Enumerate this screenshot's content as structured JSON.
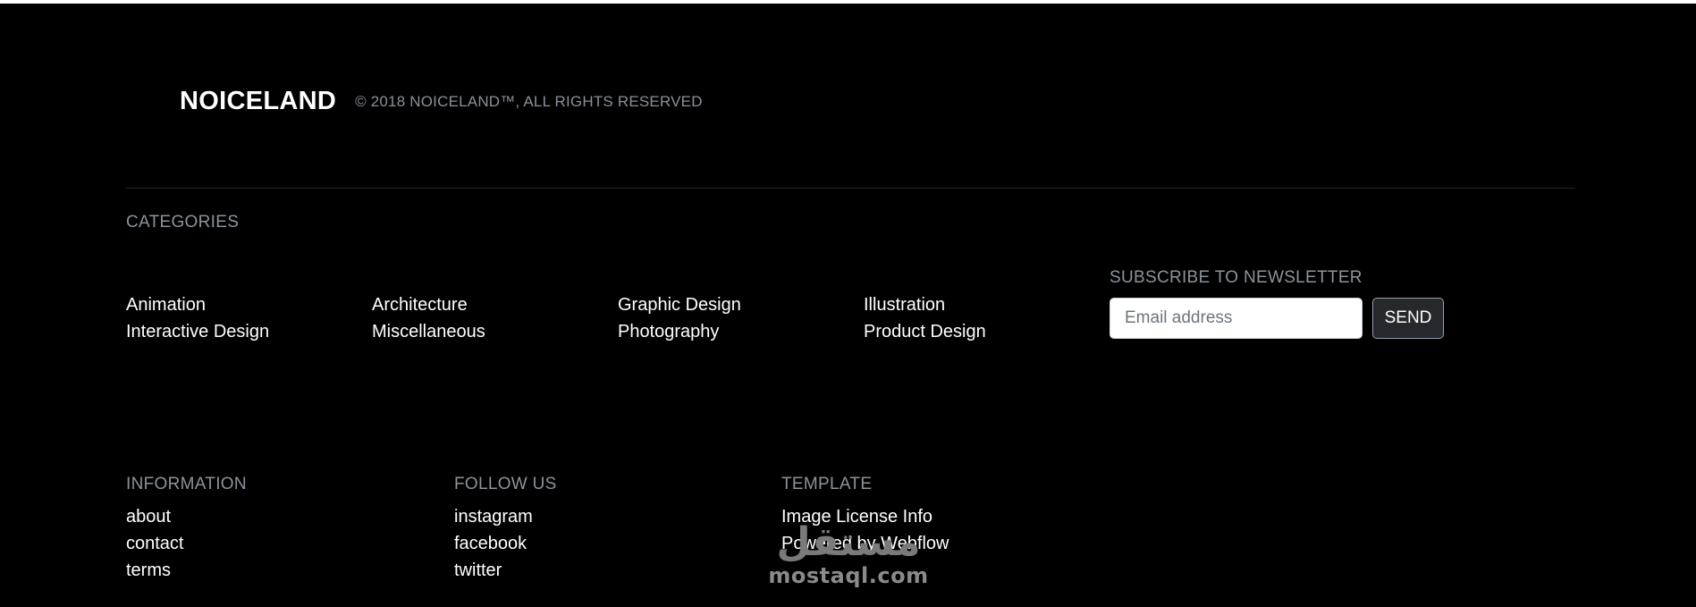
{
  "brand": {
    "name": "NOICELAND",
    "copyright": "© 2018 NOICELAND™, ALL RIGHTS RESERVED"
  },
  "categories": {
    "title": "CATEGORIES",
    "items": [
      "Animation",
      "Architecture",
      "Graphic Design",
      "Illustration",
      "Interactive Design",
      "Miscellaneous",
      "Photography",
      "Product Design"
    ]
  },
  "newsletter": {
    "title": "SUBSCRIBE TO NEWSLETTER",
    "placeholder": "Email address",
    "button": "SEND"
  },
  "information": {
    "title": "INFORMATION",
    "links": [
      "about",
      "contact",
      "terms"
    ]
  },
  "follow": {
    "title": "FOLLOW US",
    "links": [
      "instagram",
      "facebook",
      "twitter"
    ]
  },
  "template": {
    "title": "TEMPLATE",
    "links": [
      "Image License Info",
      "Powered by Webflow"
    ]
  },
  "watermark": {
    "arabic": "مستقل",
    "latin": "mostaql.com"
  }
}
